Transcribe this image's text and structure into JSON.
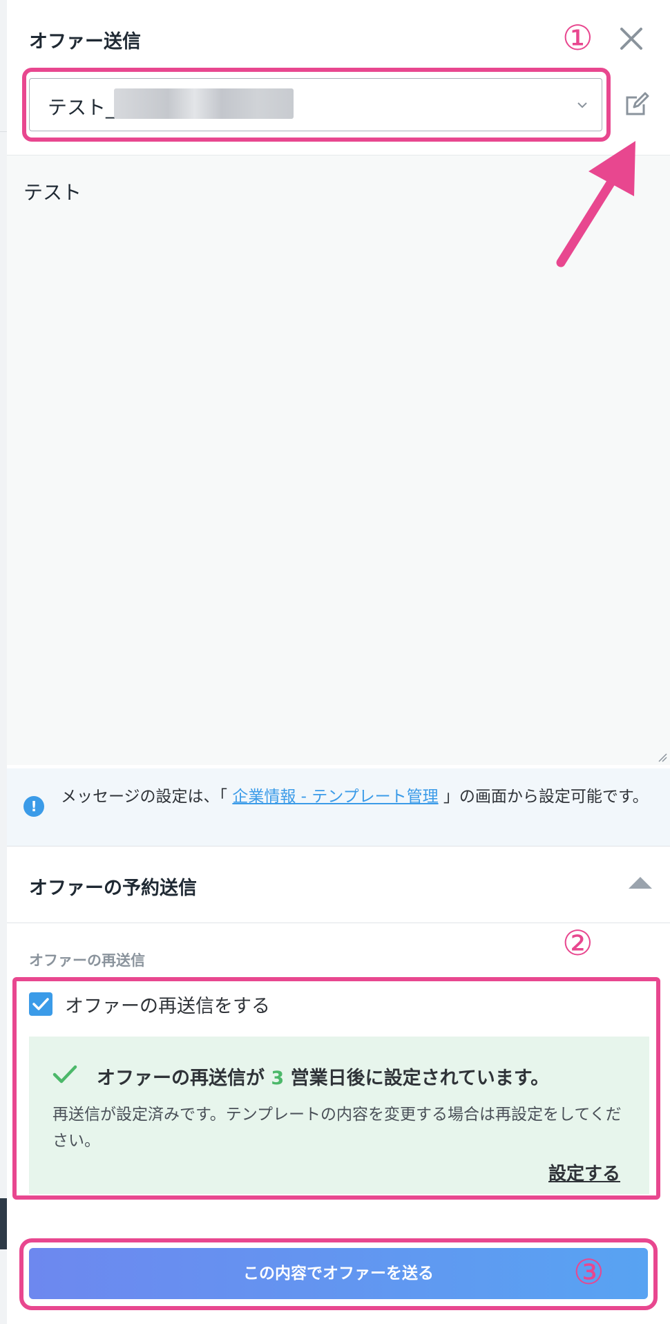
{
  "dialog": {
    "title": "オファー送信",
    "close_icon": "close-icon"
  },
  "template_select": {
    "value": "テスト_",
    "redacted": true,
    "chevron_icon": "chevron-down-icon",
    "edit_icon": "edit-icon"
  },
  "message": {
    "body": "テスト"
  },
  "info": {
    "icon": "info-icon",
    "text_before": "メッセージの設定は、「",
    "link": "企業情報 - テンプレート管理",
    "text_after": "」の画面から設定可能です。"
  },
  "schedule_section": {
    "title": "オファーの予約送信",
    "collapse_icon": "triangle-up-icon"
  },
  "resend": {
    "label": "オファーの再送信",
    "checkbox_label": "オファーの再送信をする",
    "checked": true,
    "status_before": "オファーの再送信が",
    "status_days": "3",
    "status_after": "営業日後に設定されています。",
    "description": "再送信が設定済みです。テンプレートの内容を変更する場合は再設定をしてください。",
    "settings_link": "設定する"
  },
  "submit": {
    "label": "この内容でオファーを送る"
  },
  "annotations": {
    "marker1": "①",
    "marker2": "②",
    "marker3": "③",
    "color": "#e8478f"
  },
  "colors": {
    "accent": "#3b9be8",
    "success": "#4cb86a",
    "highlight": "#e8478f"
  }
}
